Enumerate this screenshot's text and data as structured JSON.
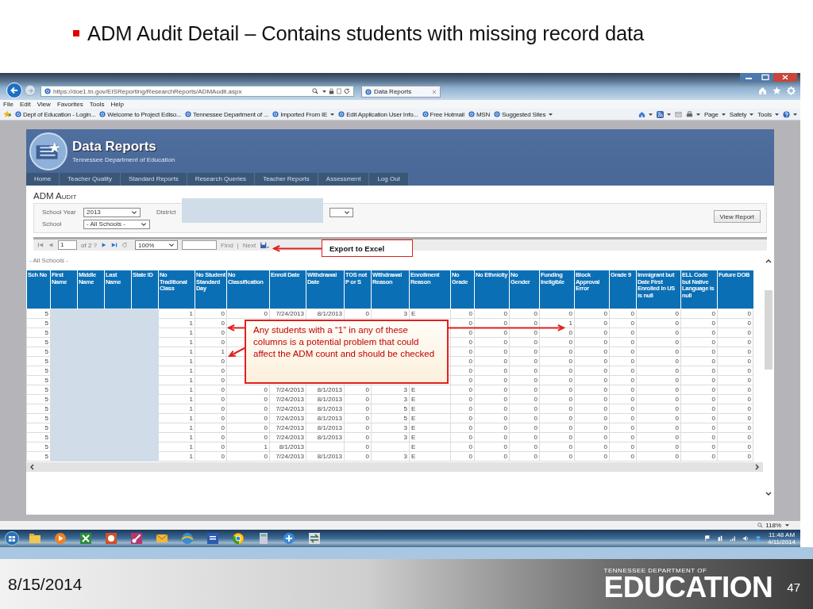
{
  "slide": {
    "title": "ADM Audit Detail – Contains students with missing record data",
    "date": "8/15/2014",
    "logo_top": "TENNESSEE DEPARTMENT OF",
    "logo_main": "EDUCATION",
    "page_number": "47"
  },
  "browser": {
    "address": "https://doe1.tn.gov/EISReporting/ResearchReports/ADMAudit.aspx",
    "tab": "Data Reports",
    "menu": [
      "File",
      "Edit",
      "View",
      "Favorites",
      "Tools",
      "Help"
    ],
    "favorites": [
      {
        "label": "Dept of Education - Login...",
        "dropdown": false
      },
      {
        "label": "Welcome to Project Ediso...",
        "dropdown": false
      },
      {
        "label": "Tennessee Department of ...",
        "dropdown": false
      },
      {
        "label": "Imported From IE",
        "dropdown": true
      },
      {
        "label": "Edit Application User Info...",
        "dropdown": false
      },
      {
        "label": "Free Hotmail",
        "dropdown": false
      },
      {
        "label": "MSN",
        "dropdown": false
      },
      {
        "label": "Suggested Sites",
        "dropdown": true
      }
    ],
    "commands": [
      {
        "label": "Page",
        "dropdown": true
      },
      {
        "label": "Safety",
        "dropdown": true
      },
      {
        "label": "Tools",
        "dropdown": true
      }
    ],
    "zoom": "118%"
  },
  "site": {
    "title": "Data Reports",
    "subtitle": "Tennessee Department of Education",
    "nav": [
      "Home",
      "Teacher Quality",
      "Standard Reports",
      "Research Queries",
      "Teacher Reports",
      "Assessment",
      "Log Out"
    ]
  },
  "report": {
    "title": "ADM Audit",
    "school_year": {
      "label": "School Year",
      "value": "2013"
    },
    "district": {
      "label": "District"
    },
    "school": {
      "label": "School",
      "value": "- All Schools -"
    },
    "view_button": "View Report",
    "toolbar": {
      "page": "1",
      "page_count": "of 2 ?",
      "zoom": "100%",
      "find": "Find",
      "separator": "|",
      "next": "Next"
    },
    "group_label": "- All Schools -"
  },
  "table": {
    "columns": [
      {
        "label": "Sch No",
        "redacted": false
      },
      {
        "label": "First Name",
        "redacted": true
      },
      {
        "label": "Middle Name",
        "redacted": true
      },
      {
        "label": "Last Name",
        "redacted": true
      },
      {
        "label": "State ID",
        "redacted": true
      },
      {
        "label": "No Traditional Class",
        "redacted": false
      },
      {
        "label": "No Student Standard Day",
        "redacted": false
      },
      {
        "label": "No Classification",
        "redacted": false
      },
      {
        "label": "Enroll Date",
        "redacted": false
      },
      {
        "label": "Withdrawal Date",
        "redacted": false
      },
      {
        "label": "TOS not P or S",
        "redacted": false
      },
      {
        "label": "Withdrawal Reason",
        "redacted": false
      },
      {
        "label": "Enrollment Reason",
        "redacted": false
      },
      {
        "label": "No Grade",
        "redacted": false
      },
      {
        "label": "No Ethnicity",
        "redacted": false
      },
      {
        "label": "No Gender",
        "redacted": false
      },
      {
        "label": "Funding Ineligible",
        "redacted": false
      },
      {
        "label": "Block Approval Error",
        "redacted": false
      },
      {
        "label": "Grade 9",
        "redacted": false
      },
      {
        "label": "Immigrant but Date First Enrolled in US is null",
        "redacted": false
      },
      {
        "label": "ELL Code but Native Language is null",
        "redacted": false
      },
      {
        "label": "Future DOB",
        "redacted": false
      }
    ],
    "rows": [
      [
        "5",
        null,
        null,
        null,
        null,
        "1",
        "0",
        "0",
        "7/24/2013",
        "8/1/2013",
        "0",
        "3",
        "E",
        "0",
        "0",
        "0",
        "0",
        "0",
        "0",
        "0",
        "0",
        "0"
      ],
      [
        "5",
        null,
        null,
        null,
        null,
        "1",
        "0",
        null,
        null,
        null,
        null,
        null,
        null,
        "0",
        "0",
        "0",
        "1",
        "0",
        "0",
        "0",
        "0",
        "0"
      ],
      [
        "5",
        null,
        null,
        null,
        null,
        "1",
        "0",
        null,
        null,
        null,
        null,
        null,
        null,
        "0",
        "0",
        "0",
        "0",
        "0",
        "0",
        "0",
        "0",
        "0"
      ],
      [
        "5",
        null,
        null,
        null,
        null,
        "1",
        "0",
        null,
        null,
        null,
        null,
        null,
        null,
        "0",
        "0",
        "0",
        "0",
        "0",
        "0",
        "0",
        "0",
        "0"
      ],
      [
        "5",
        null,
        null,
        null,
        null,
        "1",
        "1",
        null,
        null,
        null,
        null,
        null,
        null,
        "0",
        "0",
        "0",
        "0",
        "0",
        "0",
        "0",
        "0",
        "0"
      ],
      [
        "5",
        null,
        null,
        null,
        null,
        "1",
        "0",
        null,
        null,
        null,
        null,
        null,
        null,
        "0",
        "0",
        "0",
        "0",
        "0",
        "0",
        "0",
        "0",
        "0"
      ],
      [
        "5",
        null,
        null,
        null,
        null,
        "1",
        "0",
        null,
        null,
        null,
        null,
        null,
        null,
        "0",
        "0",
        "0",
        "0",
        "0",
        "0",
        "0",
        "0",
        "0"
      ],
      [
        "5",
        null,
        null,
        null,
        null,
        "1",
        "0",
        null,
        null,
        null,
        null,
        null,
        null,
        "0",
        "0",
        "0",
        "0",
        "0",
        "0",
        "0",
        "0",
        "0"
      ],
      [
        "5",
        null,
        null,
        null,
        null,
        "1",
        "0",
        "0",
        "7/24/2013",
        "8/1/2013",
        "0",
        "3",
        "E",
        "0",
        "0",
        "0",
        "0",
        "0",
        "0",
        "0",
        "0",
        "0"
      ],
      [
        "5",
        null,
        null,
        null,
        null,
        "1",
        "0",
        "0",
        "7/24/2013",
        "8/1/2013",
        "0",
        "3",
        "E",
        "0",
        "0",
        "0",
        "0",
        "0",
        "0",
        "0",
        "0",
        "0"
      ],
      [
        "5",
        null,
        null,
        null,
        null,
        "1",
        "0",
        "0",
        "7/24/2013",
        "8/1/2013",
        "0",
        "5",
        "E",
        "0",
        "0",
        "0",
        "0",
        "0",
        "0",
        "0",
        "0",
        "0"
      ],
      [
        "5",
        null,
        null,
        null,
        null,
        "1",
        "0",
        "0",
        "7/24/2013",
        "8/1/2013",
        "0",
        "5",
        "E",
        "0",
        "0",
        "0",
        "0",
        "0",
        "0",
        "0",
        "0",
        "0"
      ],
      [
        "5",
        null,
        null,
        null,
        null,
        "1",
        "0",
        "0",
        "7/24/2013",
        "8/1/2013",
        "0",
        "3",
        "E",
        "0",
        "0",
        "0",
        "0",
        "0",
        "0",
        "0",
        "0",
        "0"
      ],
      [
        "5",
        null,
        null,
        null,
        null,
        "1",
        "0",
        "0",
        "7/24/2013",
        "8/1/2013",
        "0",
        "3",
        "E",
        "0",
        "0",
        "0",
        "0",
        "0",
        "0",
        "0",
        "0",
        "0"
      ],
      [
        "5",
        null,
        null,
        null,
        null,
        "1",
        "0",
        "1",
        "8/1/2013",
        null,
        "0",
        null,
        "E",
        "0",
        "0",
        "0",
        "0",
        "0",
        "0",
        "0",
        "0",
        "0"
      ],
      [
        "5",
        null,
        null,
        null,
        null,
        "1",
        "0",
        "0",
        "7/24/2013",
        "8/1/2013",
        "0",
        "3",
        "E",
        "0",
        "0",
        "0",
        "0",
        "0",
        "0",
        "0",
        "0",
        "0"
      ]
    ]
  },
  "callouts": [
    "Export to Excel",
    "Any students with a “1” in any of these columns is a potential problem that could affect the ADM count and should be checked"
  ],
  "taskbar": {
    "time": "11:48 AM",
    "date": "4/11/2014"
  }
}
